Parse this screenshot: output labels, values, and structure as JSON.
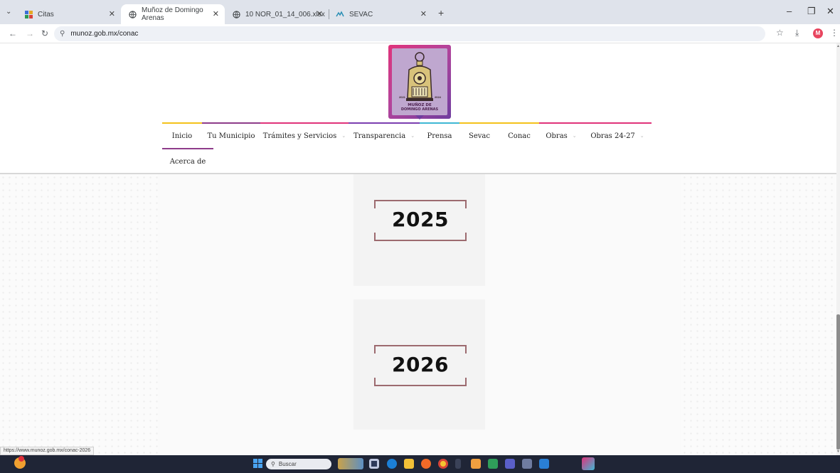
{
  "browser": {
    "tabs": [
      {
        "title": "Citas",
        "icon": "grid-apps-icon"
      },
      {
        "title": "Muñoz de Domingo Arenas",
        "icon": "globe-icon"
      },
      {
        "title": "10 NOR_01_14_006.xlsx",
        "icon": "globe-icon"
      },
      {
        "title": "SEVAC",
        "icon": "sevac-icon"
      }
    ],
    "url": "munoz.gob.mx/conac",
    "profile_initial": "M",
    "status_url": "https://www.munoz.gob.mx/conac-2026"
  },
  "site": {
    "logo": {
      "name_line1": "MUÑOZ DE",
      "name_line2": "DOMINGO ARENAS",
      "year_left": "2021",
      "year_right": "2024"
    },
    "nav": [
      {
        "label": "Inicio",
        "dropdown": false
      },
      {
        "label": "Tu Municipio",
        "dropdown": false
      },
      {
        "label": "Trámites y Servicios",
        "dropdown": true
      },
      {
        "label": "Transparencia",
        "dropdown": true
      },
      {
        "label": "Prensa",
        "dropdown": false
      },
      {
        "label": "Sevac",
        "dropdown": false
      },
      {
        "label": "Conac",
        "dropdown": false
      },
      {
        "label": "Obras",
        "dropdown": true
      },
      {
        "label": "Obras 24-27",
        "dropdown": true
      },
      {
        "label": "Acerca de",
        "dropdown": false
      }
    ],
    "years": [
      "2025",
      "2026"
    ]
  },
  "taskbar": {
    "search_placeholder": "Buscar"
  },
  "colors": {
    "nav_accents": [
      "#f4c21b",
      "#8e3c8a",
      "#e0337a",
      "#7b3fb0",
      "#3fb7d4",
      "#f4c21b",
      "#f4c21b",
      "#e0337a",
      "#e0337a",
      "#8e3c8a"
    ],
    "year_frame": "#9c6a6f"
  }
}
